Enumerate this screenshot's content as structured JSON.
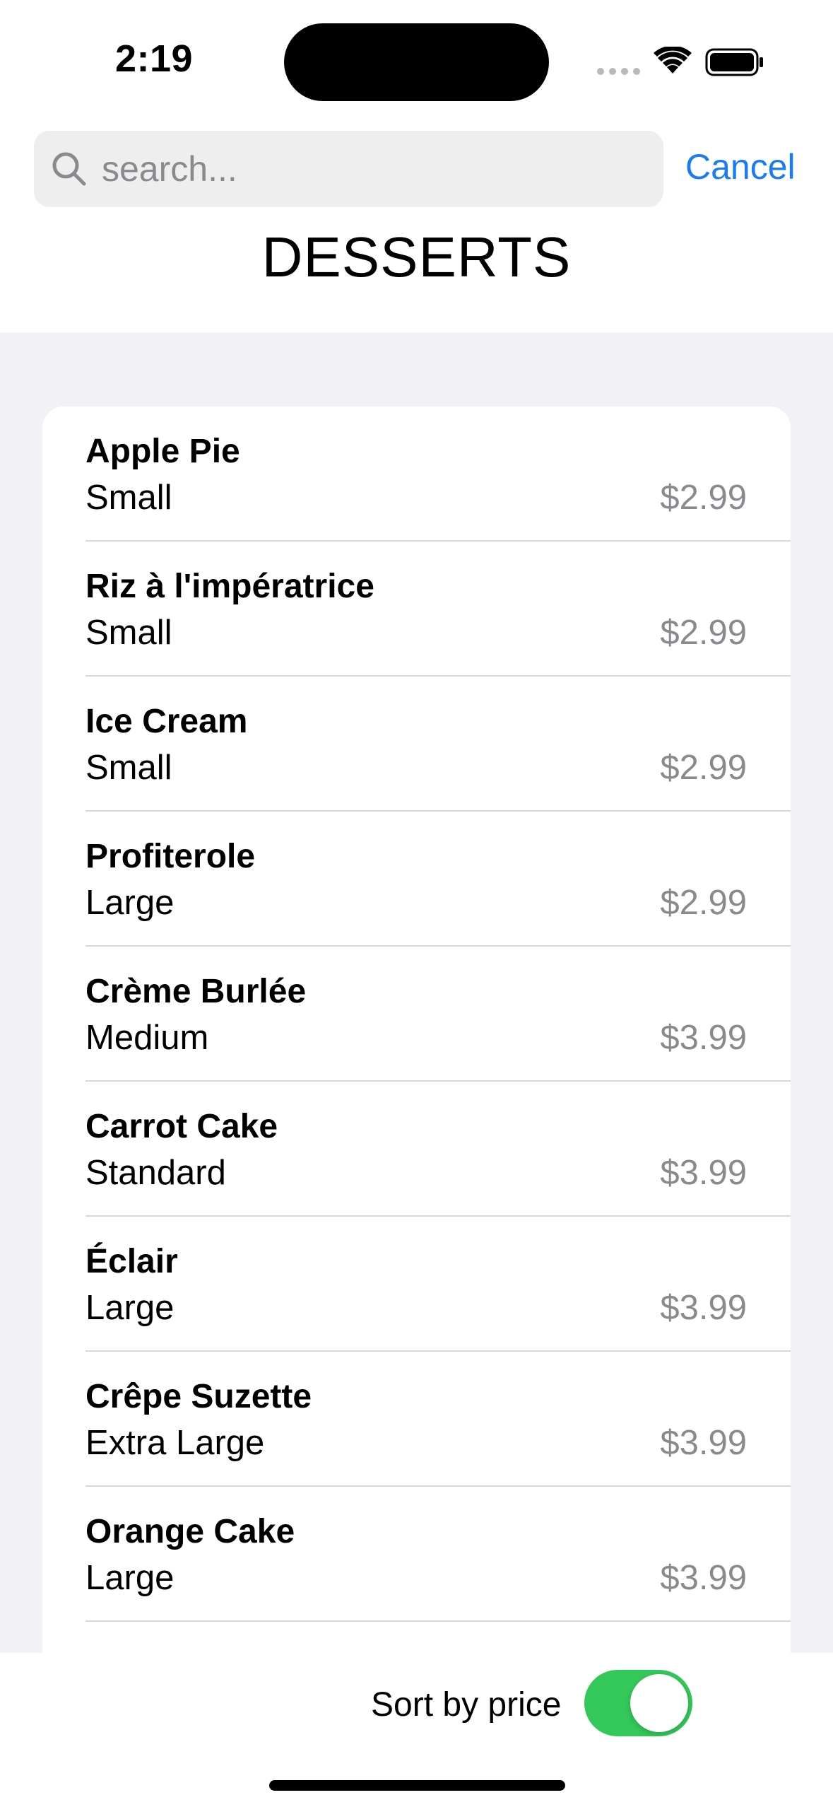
{
  "status_bar": {
    "time": "2:19"
  },
  "search": {
    "placeholder": "search...",
    "value": "",
    "cancel_label": "Cancel"
  },
  "page": {
    "title": "DESSERTS"
  },
  "desserts": [
    {
      "name": "Apple Pie",
      "size": "Small",
      "price": "$2.99"
    },
    {
      "name": "Riz à l'impératrice",
      "size": "Small",
      "price": "$2.99"
    },
    {
      "name": "Ice Cream",
      "size": "Small",
      "price": "$2.99"
    },
    {
      "name": "Profiterole",
      "size": "Large",
      "price": "$2.99"
    },
    {
      "name": "Crème Burlée",
      "size": "Medium",
      "price": "$3.99"
    },
    {
      "name": "Carrot Cake",
      "size": "Standard",
      "price": "$3.99"
    },
    {
      "name": "Éclair",
      "size": "Large",
      "price": "$3.99"
    },
    {
      "name": "Crêpe Suzette",
      "size": "Extra Large",
      "price": "$3.99"
    },
    {
      "name": "Orange Cake",
      "size": "Large",
      "price": "$3.99"
    }
  ],
  "toolbar": {
    "sort_label": "Sort by price",
    "sort_enabled": true
  },
  "colors": {
    "accent": "#1a7cf2",
    "toggle_on": "#34c759",
    "secondary_text": "#8a8a8e",
    "grouped_background": "#f1f1f6"
  },
  "icons": {
    "search": "magnifying-glass",
    "wifi": "wifi",
    "battery": "battery-full"
  }
}
